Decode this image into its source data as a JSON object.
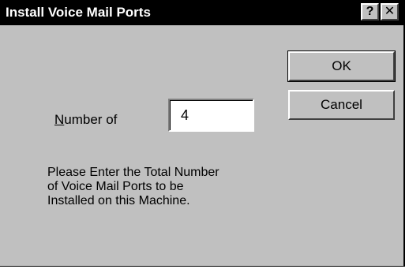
{
  "window": {
    "title": "Install Voice Mail Ports",
    "help_label": "?",
    "close_label": "✕"
  },
  "buttons": {
    "ok_label": "OK",
    "cancel_label": "Cancel"
  },
  "number_field": {
    "label_mnemonic": "N",
    "label_rest": "umber of",
    "value": "4"
  },
  "instructions": {
    "line1": "Please Enter the Total Number",
    "line2": "of Voice Mail Ports to be",
    "line3": "Installed on this Machine."
  }
}
